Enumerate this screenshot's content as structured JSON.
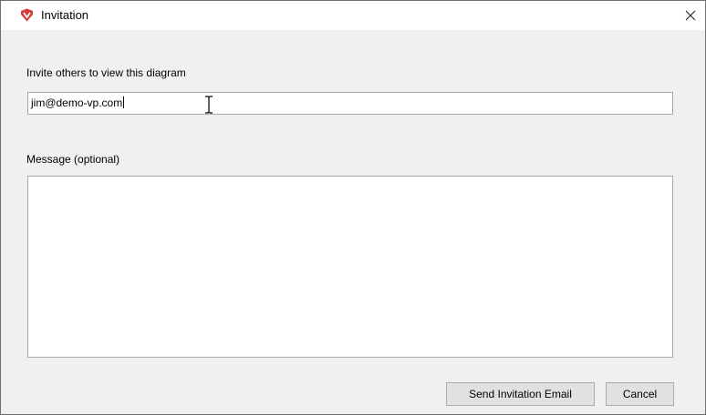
{
  "window": {
    "title": "Invitation",
    "app_icon": "visual-paradigm-logo-icon",
    "close_icon": "close-icon",
    "accent_color": "#d33b3b"
  },
  "form": {
    "invite_label": "Invite others to view this diagram",
    "email_value": "jim@demo-vp.com",
    "message_label": "Message (optional)",
    "message_value": ""
  },
  "buttons": {
    "send_label": "Send Invitation Email",
    "cancel_label": "Cancel"
  }
}
